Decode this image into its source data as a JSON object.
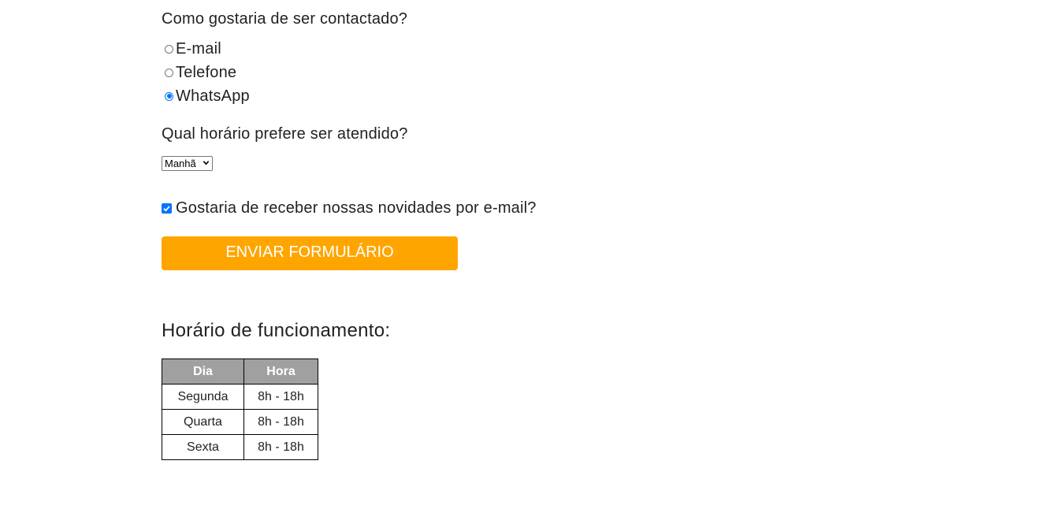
{
  "contact": {
    "question": "Como gostaria de ser contactado?",
    "options": [
      {
        "label": "E-mail",
        "checked": false
      },
      {
        "label": "Telefone",
        "checked": false
      },
      {
        "label": "WhatsApp",
        "checked": true
      }
    ]
  },
  "schedule": {
    "question": "Qual horário prefere ser atendido?",
    "selected": "Manhã"
  },
  "newsletter": {
    "label": "Gostaria de receber nossas novidades por e-mail?",
    "checked": true
  },
  "submit": {
    "label": "ENVIAR FORMULÁRIO"
  },
  "hours": {
    "title": "Horário de funcionamento:",
    "headers": [
      "Dia",
      "Hora"
    ],
    "rows": [
      [
        "Segunda",
        "8h - 18h"
      ],
      [
        "Quarta",
        "8h - 18h"
      ],
      [
        "Sexta",
        "8h - 18h"
      ]
    ]
  },
  "colors": {
    "accent": "#ffa500",
    "checked": "#0075ff",
    "table_header": "#a0a0a0"
  }
}
